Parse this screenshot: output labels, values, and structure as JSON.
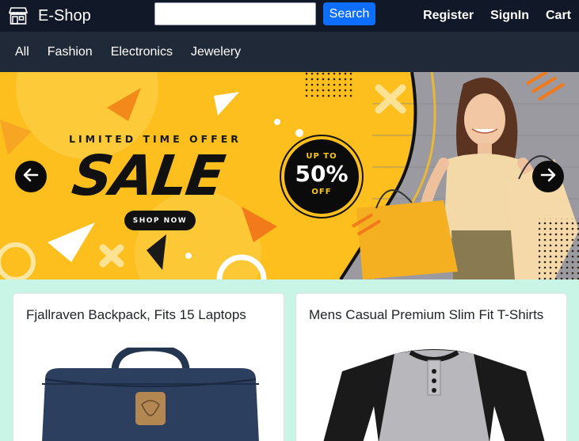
{
  "header": {
    "brand": "E-Shop",
    "search": {
      "value": "",
      "placeholder": "",
      "button_label": "Search"
    },
    "links": [
      "Register",
      "SignIn",
      "Cart"
    ]
  },
  "categories": [
    "All",
    "Fashion",
    "Electronics",
    "Jewelery"
  ],
  "banner": {
    "headline": "LIMITED TIME OFFER",
    "sale": "SALE",
    "cta": "SHOP NOW",
    "badge": {
      "top": "UP TO",
      "value": "50%",
      "bottom": "OFF"
    },
    "prev_icon": "arrow-left-icon",
    "next_icon": "arrow-right-icon"
  },
  "products": [
    {
      "title": "Fjallraven Backpack, Fits 15 Laptops",
      "image": "backpack"
    },
    {
      "title": "Mens Casual Premium Slim Fit T-Shirts",
      "image": "raglan-tshirt"
    }
  ],
  "colors": {
    "topbar": "#111827",
    "catbar": "#1f2937",
    "accent": "#0d6efd",
    "page_bg": "#c9f5e6",
    "banner_yellow": "#fcbf1e"
  }
}
